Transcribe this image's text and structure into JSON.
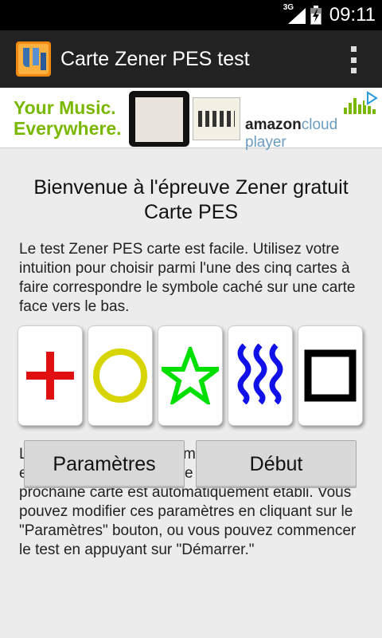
{
  "status_bar": {
    "network": "3G",
    "time": "09:11"
  },
  "action_bar": {
    "title": "Carte Zener PES test",
    "icons": {
      "app": "app-logo-icon",
      "menu": "overflow-menu-icon"
    }
  },
  "ad": {
    "tagline_line1": "Your Music.",
    "tagline_line2": "Everywhere.",
    "brand_bold": "amazon",
    "brand_light": "cloud player",
    "colors": {
      "tagline": "#7ab800"
    }
  },
  "main": {
    "heading": "Bienvenue à l'épreuve Zener gratuit Carte PES",
    "intro": "Le test Zener PES carte est facile. Utilisez votre intuition pour choisir parmi l'une des cinq cartes à faire correspondre le symbole caché sur une carte face vers le bas.",
    "cards": [
      {
        "symbol": "cross-icon",
        "color": "#e01010"
      },
      {
        "symbol": "circle-icon",
        "color": "#d8d400"
      },
      {
        "symbol": "star-icon",
        "color": "#00e000"
      },
      {
        "symbol": "waves-icon",
        "color": "#1010e8"
      },
      {
        "symbol": "square-icon",
        "color": "#000000"
      }
    ],
    "description": "Le test est actuellement mis en place pour 35 essais, avec un deuxième retard 3 avant la prochaine carte est automatiquement établi. Vous pouvez modifier ces paramètres en cliquant sur le \"Paramètres\" bouton, ou vous pouvez commencer le test en appuyant sur \"Démarrer.\""
  },
  "buttons": {
    "settings_label": "Paramètres",
    "start_label": "Début"
  }
}
